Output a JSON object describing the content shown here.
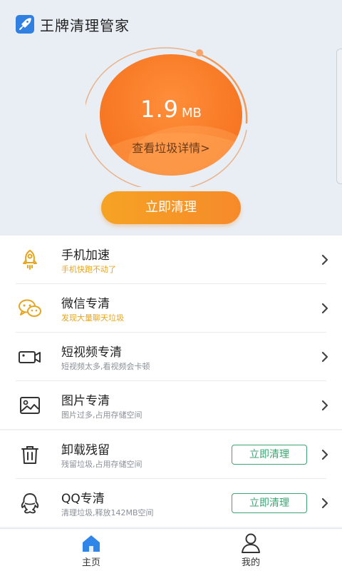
{
  "app": {
    "title": "王牌清理管家",
    "icon": "rocket-icon"
  },
  "scan": {
    "size_value": "1.9",
    "size_unit": "MB",
    "detail_link": "查看垃圾详情>",
    "clean_button": "立即清理"
  },
  "colors": {
    "accent_orange": "#f6a324",
    "ball_orange": "#f87a26",
    "green": "#3fa373",
    "highlight_yellow": "#e7a51d",
    "nav_blue": "#2f86e8"
  },
  "list": {
    "items": [
      {
        "title": "手机加速",
        "subtitle": "手机快跑不动了",
        "icon": "rocket-outline-icon",
        "action": ""
      },
      {
        "title": "微信专清",
        "subtitle": "发现大量聊天垃圾",
        "icon": "wechat-icon",
        "action": ""
      },
      {
        "title": "短视频专清",
        "subtitle": "短视频太多,看视频会卡顿",
        "icon": "video-camera-icon",
        "action": ""
      },
      {
        "title": "图片专清",
        "subtitle": "图片过多,占用存储空间",
        "icon": "image-icon",
        "action": ""
      },
      {
        "title": "卸载残留",
        "subtitle": "残留垃圾,占用存储空间",
        "icon": "trash-icon",
        "action": "立即清理"
      },
      {
        "title": "QQ专清",
        "subtitle": "清理垃圾,释放142MB空间",
        "icon": "qq-penguin-icon",
        "action": "立即清理"
      }
    ]
  },
  "nav": {
    "home_label": "主页",
    "mine_label": "我的",
    "home_icon": "home-icon",
    "mine_icon": "user-icon",
    "active": "主页"
  }
}
